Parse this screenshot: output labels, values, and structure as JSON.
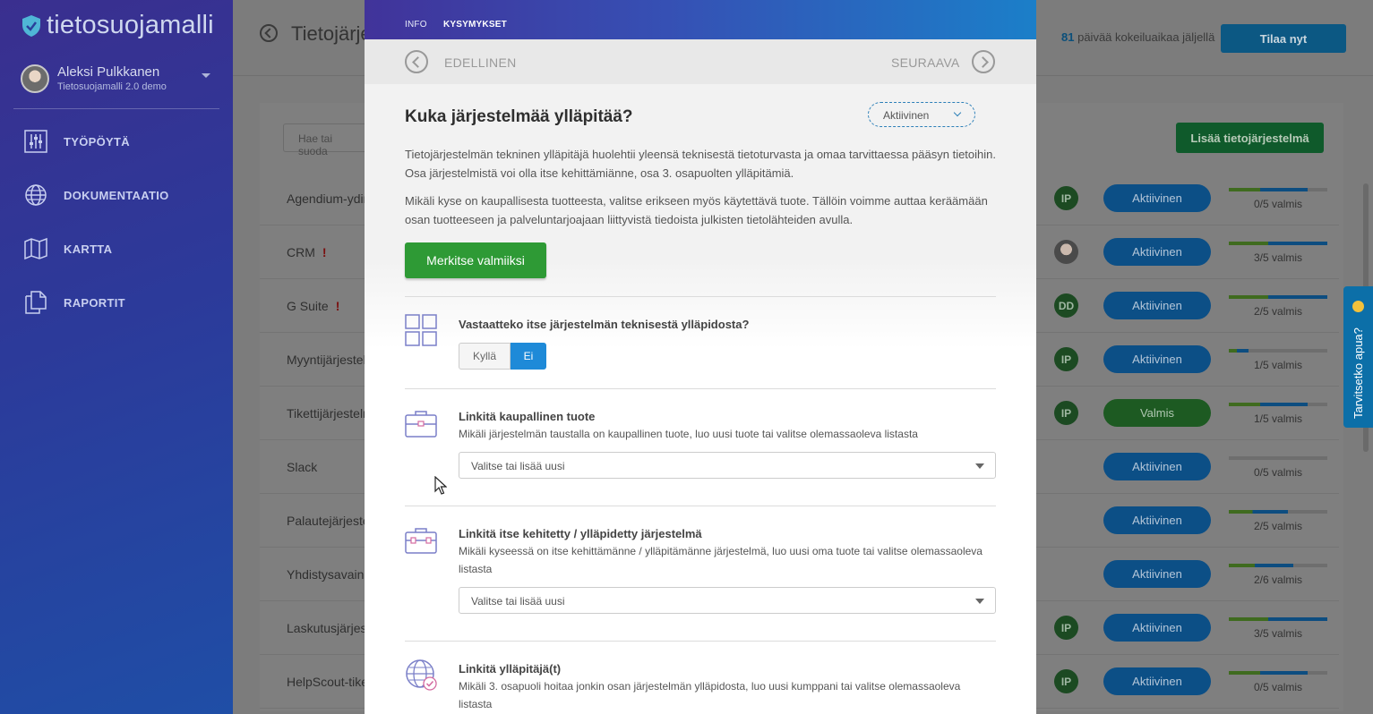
{
  "sidebar": {
    "logo_text": "tietosuojamalli",
    "user": {
      "name": "Aleksi Pulkkanen",
      "org": "Tietosuojamalli 2.0 demo"
    },
    "nav": [
      {
        "label": "TYÖPÖYTÄ",
        "icon": "sliders-icon"
      },
      {
        "label": "DOKUMENTAATIO",
        "icon": "globe-icon"
      },
      {
        "label": "KARTTA",
        "icon": "map-icon"
      },
      {
        "label": "RAPORTIT",
        "icon": "documents-icon"
      }
    ]
  },
  "header": {
    "title": "Tietojärje",
    "trial_days": "81",
    "trial_text": "päivää kokeiluaikaa jäljellä",
    "order_label": "Tilaa nyt"
  },
  "list": {
    "search_placeholder": "Hae tai suoda",
    "add_label": "Lisää tietojärjestelmä",
    "rows": [
      {
        "name": "Agendium-ydin",
        "warn": "",
        "owner": "IP",
        "status": "Aktiivinen",
        "progress": 0.8,
        "progress_label": "0/5 valmis"
      },
      {
        "name": "CRM",
        "warn": "!",
        "owner": "",
        "status": "Aktiivinen",
        "progress": 1.0,
        "progress_label": "3/5 valmis"
      },
      {
        "name": "G Suite",
        "warn": "!",
        "owner": "DD",
        "status": "Aktiivinen",
        "progress": 1.0,
        "progress_label": "2/5 valmis"
      },
      {
        "name": "Myyntijärjestel",
        "warn": "",
        "owner": "IP",
        "status": "Aktiivinen",
        "progress": 0.2,
        "progress_label": "1/5 valmis"
      },
      {
        "name": "Tikettijärjestelm",
        "warn": "",
        "owner": "IP",
        "status": "Valmis",
        "progress": 0.8,
        "progress_label": "1/5 valmis"
      },
      {
        "name": "Slack",
        "warn": "",
        "owner": "",
        "status": "Aktiivinen",
        "progress": 0.0,
        "progress_label": "0/5 valmis"
      },
      {
        "name": "Palautejärjeste",
        "warn": "",
        "owner": "",
        "status": "Aktiivinen",
        "progress": 0.6,
        "progress_label": "2/5 valmis"
      },
      {
        "name": "Yhdistysavain",
        "warn": "",
        "owner": "",
        "status": "Aktiivinen",
        "progress": 0.65,
        "progress_label": "2/6 valmis"
      },
      {
        "name": "Laskutusjärjes",
        "warn": "",
        "owner": "IP",
        "status": "Aktiivinen",
        "progress": 1.0,
        "progress_label": "3/5 valmis"
      },
      {
        "name": "HelpScout-tike",
        "warn": "",
        "owner": "IP",
        "status": "Aktiivinen",
        "progress": 0.8,
        "progress_label": "0/5 valmis"
      }
    ]
  },
  "help": {
    "label": "Tarvitsetko apua?"
  },
  "modal": {
    "tabs": {
      "info": "INFO",
      "questions": "KYSYMYKSET"
    },
    "nav": {
      "prev": "EDELLINEN",
      "next": "SEURAAVA"
    },
    "title": "Kuka järjestelmää ylläpitää?",
    "state": "Aktiivinen",
    "desc1": "Tietojärjestelmän tekninen ylläpitäjä huolehtii yleensä teknisestä tietoturvasta ja omaa tarvittaessa pääsyn tietoihin. Osa järjestelmistä voi olla itse kehittämiänne, osa 3. osapuolten ylläpitämiä.",
    "desc2": "Mikäli kyse on kaupallisesta tuotteesta, valitse erikseen myös käytettävä tuote. Tällöin voimme auttaa keräämään osan tuotteeseen ja palveluntarjoajaan liittyvistä tiedoista julkisten tietolähteiden avulla.",
    "mark_done": "Merkitse valmiiksi",
    "sections": {
      "own": {
        "title": "Vastaatteko itse järjestelmän teknisestä ylläpidosta?",
        "yes": "Kyllä",
        "no": "Ei",
        "selected": "Ei"
      },
      "commercial": {
        "title": "Linkitä kaupallinen tuote",
        "desc": "Mikäli järjestelmän taustalla on kaupallinen tuote, luo uusi tuote tai valitse olemassaoleva listasta",
        "select": "Valitse tai lisää uusi"
      },
      "selfmade": {
        "title": "Linkitä itse kehitetty / ylläpidetty järjestelmä",
        "desc": "Mikäli kyseessä on itse kehittämänne / ylläpitämänne järjestelmä, luo uusi oma tuote tai valitse olemassaoleva listasta",
        "select": "Valitse tai lisää uusi"
      },
      "maintainer": {
        "title": "Linkitä ylläpitäjä(t)",
        "desc": "Mikäli 3. osapuoli hoitaa jonkin osan järjestelmän ylläpidosta, luo uusi kumppani tai valitse olemassaoleva listasta"
      }
    }
  },
  "colors": {
    "accent": "#1e8ad8",
    "success": "#2e9a35",
    "header_start": "#41339a",
    "header_end": "#1b7fc9"
  }
}
